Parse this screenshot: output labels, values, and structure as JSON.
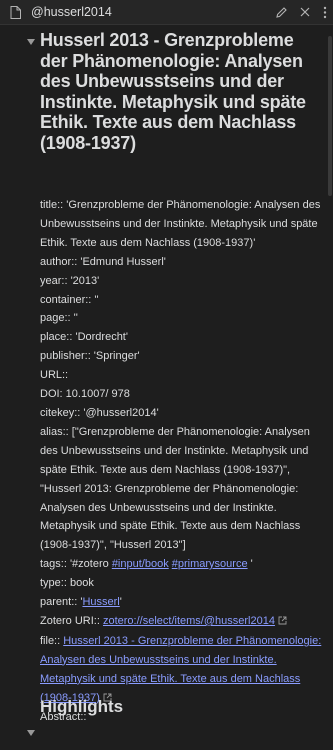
{
  "tab": {
    "title": "@husserl2014"
  },
  "note": {
    "title": "Husserl 2013 - Grenzprobleme der Phänomenologie: Analysen des Unbewusstseins und der Instinkte. Metaphysik und späte Ethik. Texte aus dem Nachlass (1908-1937)",
    "props": {
      "title": "title:: 'Grenzprobleme der Phänomenologie: Analysen des Unbewusstseins und der Instinkte. Metaphysik und späte Ethik. Texte aus dem Nachlass (1908-1937)'",
      "author": "author:: 'Edmund Husserl'",
      "year": "year:: '2013'",
      "container": "container:: ''",
      "page": "page:: ''",
      "place": "place:: 'Dordrecht'",
      "publisher": "publisher:: 'Springer'",
      "url": "URL::",
      "doi": "DOI: 10.1007/ 978",
      "citekey": "citekey:: '@husserl2014'",
      "alias": "alias:: [\"Grenzprobleme der Phänomenologie: Analysen des Unbewusstseins und der Instinkte. Metaphysik und späte Ethik. Texte aus dem Nachlass (1908-1937)\", \"Husserl 2013: Grenzprobleme der Phänomenologie: Analysen des Unbewusstseins und der Instinkte. Metaphysik und späte Ethik. Texte aus dem Nachlass (1908-1937)\", \"Husserl 2013\"]",
      "tags_prefix": "tags:: '#zotero ",
      "tag_input_book": "#input/book",
      "tag_primarysource": "#primarysource",
      "tags_suffix": " '",
      "type": "type:: book",
      "parent_prefix": "parent:: '",
      "parent_link": "Husserl",
      "parent_suffix": "'",
      "zotero_uri_label": "Zotero URI:: ",
      "zotero_uri_link": "zotero://select/items/@husserl2014",
      "file_label": "file:: ",
      "file_link": "Husserl 2013 - Grenzprobleme der Phänomenologie: Analysen des Unbewusstseins und der Instinkte. Metaphysik und späte Ethik. Texte aus dem Nachlass (1908-1937)",
      "abstract": "Abstract::"
    },
    "highlights_heading": "Highlights"
  },
  "colors": {
    "background": "#1e1e1e",
    "text": "#dcddde",
    "link": "#8a9cff"
  },
  "icons": [
    "document-icon",
    "edit-icon",
    "close-icon",
    "more-vertical-icon",
    "collapse-arrow-icon",
    "external-link-icon"
  ]
}
